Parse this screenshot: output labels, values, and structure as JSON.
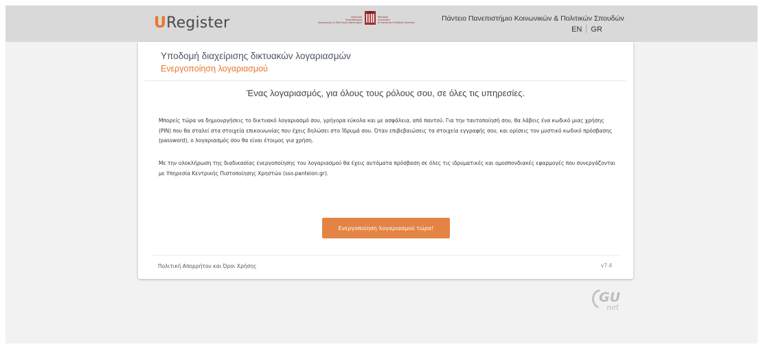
{
  "header": {
    "brand_prefix": "U",
    "brand_rest": "Register",
    "university_logo": {
      "left_text": [
        "Πάντειον",
        "Πανεπιστήμιο",
        "Κοινωνικών & Πολιτικών Επιστημών"
      ],
      "right_text": [
        "Panteion",
        "University",
        "of Social and Political Sciences"
      ]
    },
    "university_name": "Πάντειο Πανεπιστήμιο Κοινωνικών & Πολιτικών Σπουδών",
    "lang_en": "EN",
    "lang_gr": "GR"
  },
  "card": {
    "title": "Υποδομή διαχείρισης δικτυακών λογαριασμών",
    "subtitle": "Ενεργοποίηση λογαριασμού",
    "tagline": "Ένας λογαριασμός, για όλους τους ρόλους σου, σε όλες τις υπηρεσίες.",
    "paragraph1": "Μπορείς τώρα να δημιουργήσεις το δικτυακό λογαριασμό σου, γρήγορα εύκολα και με ασφάλεια, από παντού. Για την ταυτοποίησή σου, θα λάβεις ένα κωδικό μιας χρήσης (PIN) που θα σταλεί στα στοιχεία επικοινωνίας που έχεις δηλώσει στο Ίδρυμά σου. Όταν επιβεβαιώσεις τα στοιχεία εγγραφής σου, και ορίσεις τον μυστικό κωδικό πρόσβασης (password), ο λογαριασμός σου θα είναι έτοιμος για χρήση.",
    "paragraph2": "Με την ολοκλήρωση της διαδικασίας ενεργοποίησης του λογαριασμού θα έχεις αυτόματα πρόσβαση σε όλες τις ιδρυματικές και ομοσπονδιακές εφαρμογές που συνεργάζονται με Υπηρεσία Κεντρικής Πιστοποίησης Χρηστών (sso.panteion.gr).",
    "activate_button": "Ενεργοποίηση λογαριασμού τώρα!",
    "footer_link": "Πολιτική Απορρήτου και Όροι Χρήσης",
    "version": "v7.4"
  },
  "footer_logo": {
    "text_main": "GU",
    "text_sub": "net"
  },
  "colors": {
    "accent": "#e8762c",
    "button": "#e38444",
    "header_bg": "#d9d9d9",
    "page_bg": "#f2f2f2"
  }
}
